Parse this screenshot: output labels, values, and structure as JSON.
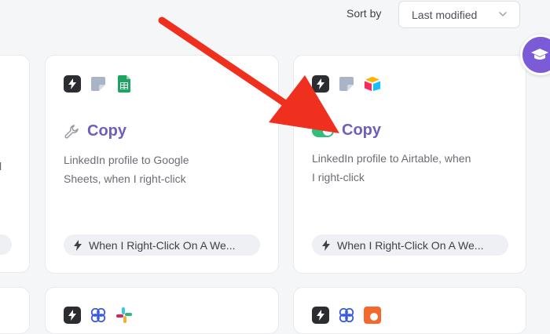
{
  "sort": {
    "label": "Sort by",
    "value": "Last modified"
  },
  "cards": [
    {
      "title": "Copy",
      "description_line1": "LinkedIn profile to Google",
      "description_line2": "Sheets, when I right-click",
      "trigger": "When I Right-Click On A We..."
    },
    {
      "title": "Copy",
      "description_line1": "LinkedIn profile to Airtable, when",
      "description_line2": "I right-click",
      "trigger": "When I Right-Click On A We...",
      "enabled": true
    }
  ],
  "partial_card": {
    "text_line1": "l"
  },
  "icons": {
    "bolt": "lightning-bolt-icon",
    "note": "page-icon",
    "sheets": "google-sheets-icon",
    "airtable": "airtable-icon",
    "wrench": "wrench-icon",
    "link": "linked-loops-icon",
    "slack": "slack-icon",
    "help": "graduation-cap-icon"
  },
  "colors": {
    "accent": "#6e5fbe",
    "toggle_on": "#2fbf7b",
    "arrow": "#f0301e",
    "help_badge": "#7b5cd6"
  }
}
